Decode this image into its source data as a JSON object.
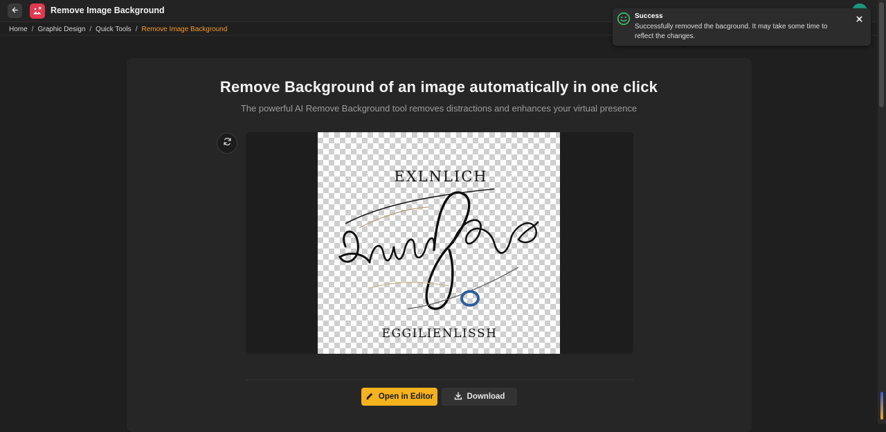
{
  "header": {
    "title": "Remove Image Background",
    "back_icon": "arrow-left-icon",
    "app_icon": "image-remove-icon",
    "app_icon_color": "#e0384f"
  },
  "breadcrumb": {
    "items": [
      "Home",
      "Graphic Design",
      "Quick Tools"
    ],
    "separator": "/",
    "current": "Remove Image Background",
    "current_color": "#f59a2a"
  },
  "main": {
    "headline": "Remove Background of an image automatically in one click",
    "subline": "The powerful AI Remove Background tool removes distractions and enhances your virtual presence",
    "refresh_icon": "refresh-icon",
    "preview": {
      "top_text": "EXLNLICH",
      "bottom_text": "EGGILIENLISSH"
    }
  },
  "actions": {
    "open_editor": "Open in Editor",
    "download": "Download",
    "accent": "#f5b21d"
  },
  "toast": {
    "title": "Success",
    "message": "Successfully removed the bacground. It may take some time to reflect the changes.",
    "icon": "smile-icon",
    "icon_color": "#3ec46d"
  }
}
